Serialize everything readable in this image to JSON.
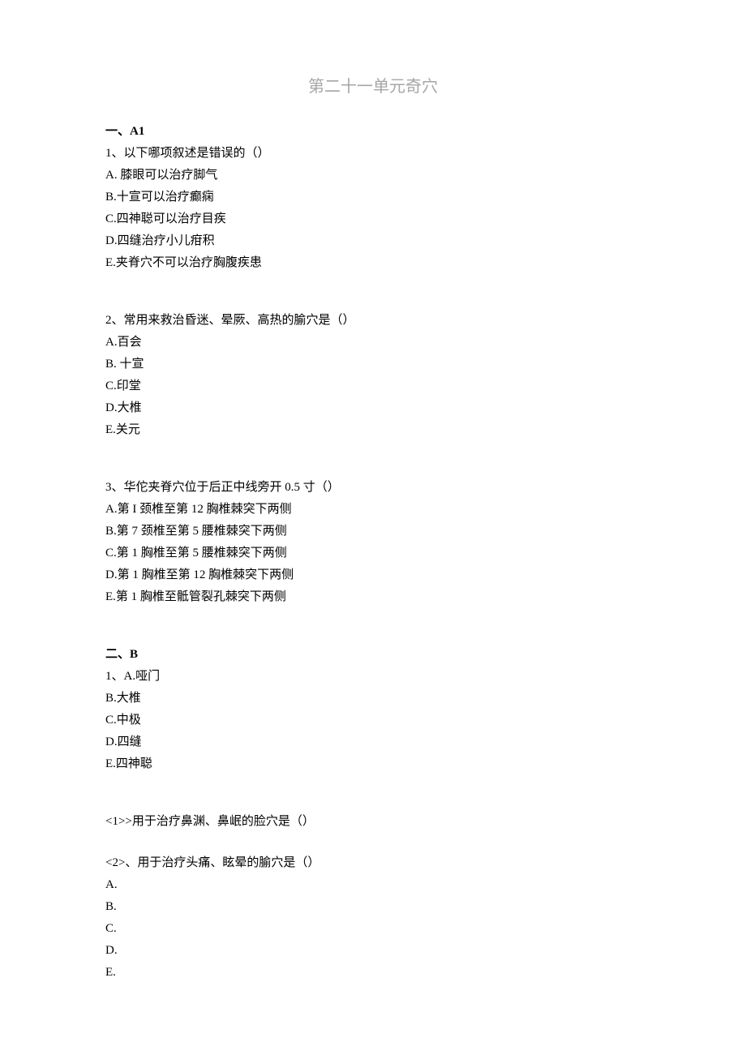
{
  "title": "第二十一单元奇穴",
  "section1": {
    "heading": "一、A1",
    "q1": {
      "stem": "1、以下哪项叙述是错误的（）",
      "a": "A. 膝眼可以治疗脚气",
      "b": "B.十宣可以治疗癫痫",
      "c": "C.四神聪可以治疗目疾",
      "d": "D.四缝治疗小儿疳积",
      "e": "E.夹脊穴不可以治疗胸腹疾患"
    },
    "q2": {
      "stem": "2、常用来救治昏迷、晕厥、高热的腧穴是（）",
      "a": "A.百会",
      "b": "B. 十宣",
      "c": "C.印堂",
      "d": "D.大椎",
      "e": "E.关元"
    },
    "q3": {
      "stem": "3、华佗夹脊穴位于后正中线旁开 0.5 寸（）",
      "a": "A.第 I 颈椎至第 12 胸椎棘突下两侧",
      "b": "B.第 7 颈椎至第 5 腰椎棘突下两侧",
      "c": "C.第 1 胸椎至第 5 腰椎棘突下两侧",
      "d": "D.第 1 胸椎至第 12 胸椎棘突下两侧",
      "e": "E.第 1 胸椎至骶管裂孔棘突下两侧"
    }
  },
  "section2": {
    "heading": "二、B",
    "shared": {
      "a": "1、A.哑门",
      "b": "B.大椎",
      "c": "C.中极",
      "d": "D.四缝",
      "e": "E.四神聪"
    },
    "sub1": "<1>>用于治疗鼻渊、鼻岷的脸穴是（）",
    "sub2": {
      "stem": "<2>、用于治疗头痛、眩晕的腧穴是（）",
      "a": "A.",
      "b": "B.",
      "c": "C.",
      "d": "D.",
      "e": "E."
    }
  }
}
